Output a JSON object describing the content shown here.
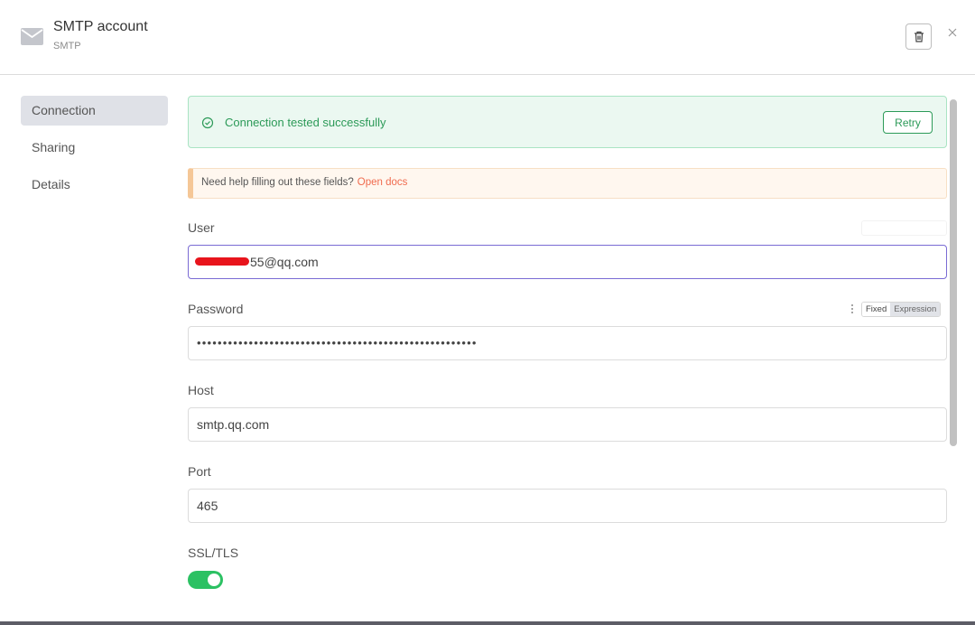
{
  "header": {
    "title": "SMTP account",
    "subtitle": "SMTP",
    "icon": "mail-icon",
    "actions": [
      "trash-icon",
      "close-icon"
    ]
  },
  "sidebar": {
    "items": [
      {
        "label": "Connection",
        "active": true
      },
      {
        "label": "Sharing",
        "active": false
      },
      {
        "label": "Details",
        "active": false
      }
    ]
  },
  "banner": {
    "success_text": "Connection tested successfully",
    "retry_label": "Retry",
    "help_text": "Need help filling out these fields?",
    "help_link": "Open docs"
  },
  "fields": {
    "user": {
      "label": "User",
      "value": "55@qq.com"
    },
    "password": {
      "label": "Password",
      "value": "••••••••••••••••••••••••••••••••••••••••••••••••••••••"
    },
    "host": {
      "label": "Host",
      "value": "smtp.qq.com"
    },
    "port": {
      "label": "Port",
      "value": "465"
    },
    "ssl": {
      "label": "SSL/TLS",
      "enabled": true
    }
  },
  "mode_toggle": {
    "fixed": "Fixed",
    "expression": "Expression"
  },
  "colors": {
    "success": "#2c9a58",
    "link": "#f06b4e",
    "toggle_on": "#2cc163",
    "focus": "#7a6bd4"
  }
}
